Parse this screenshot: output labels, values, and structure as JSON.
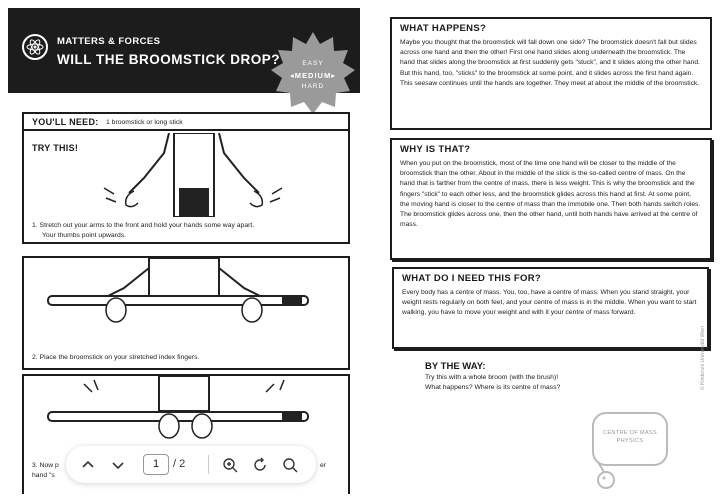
{
  "header": {
    "section": "MATTERS & FORCES",
    "title": "WILL THE BROOMSTICK DROP?"
  },
  "difficulty": {
    "easy": "EASY",
    "medium": "MEDIUM",
    "hard": "HARD"
  },
  "needs": {
    "label": "YOU'LL NEED:",
    "value": "1 broomstick or long stick"
  },
  "try_this": "TRY THIS!",
  "steps": [
    {
      "line1": "1. Stretch out your arms to the front and hold your hands some way apart.",
      "line2": "Your thumbs point upwards."
    },
    {
      "line1": "2. Place the broomstick on your stretched index fingers.",
      "line2": ""
    },
    {
      "line1": "3. Now p",
      "line2": "hand \"s",
      "tail": "er"
    }
  ],
  "what_happens": {
    "title": "WHAT HAPPENS?",
    "text": "Maybe you thought that the broomstick will fall down one side? The broomstick doesn't fall but slides across one hand and then the other! First one hand slides along underneath the broomstick. The hand that slides along the broomstick at first suddenly gets \"stuck\", and it slides along the other hand. But this hand, too, \"sticks\" to the broomstick at some point, and it slides across the first hand again. This seesaw continues until the hands are together. They meet at about the middle of the broomstick."
  },
  "why": {
    "title": "WHY IS THAT?",
    "text": "When you put on the broomstick, most of the time one hand will be closer to the middle of the broomstick than the other. About in the middle of the stick is the so-called centre of mass. On the hand that is farther from the centre of mass, there is less weight. This is why the broomstick and the fingers \"stick\" to each other less, and the broomstick glides across this hand at first. At some point, the moving hand is closer to the centre of mass than the immobile one. Then both hands switch roles. The broomstick glides across one, then the other hand, until both hands have arrived at the centre of mass."
  },
  "need": {
    "title": "WHAT DO I NEED THIS FOR?",
    "text": "Every body has a centre of mass. You, too, have a centre of mass. When you stand straight, your weight rests regularly on both feet, and your centre of mass is in the middle. When you want to start walking, you have to move your weight and with it your centre of mass forward."
  },
  "by_the_way": {
    "title": "BY THE WAY:",
    "line1": "Try this with a whole broom (with the brush)!",
    "line2": "What happens? Where is its centre of mass?"
  },
  "bubble": {
    "line1": "CENTRE OF MASS",
    "line2": "PHYSICS"
  },
  "copyright": "© Kinderuni Universität Wien",
  "toolbar": {
    "page": "1",
    "total": "/ 2"
  },
  "colors": {
    "header_bg": "#1c1c1c",
    "badge": "#9a9a9a",
    "accent": "#ffffff"
  }
}
